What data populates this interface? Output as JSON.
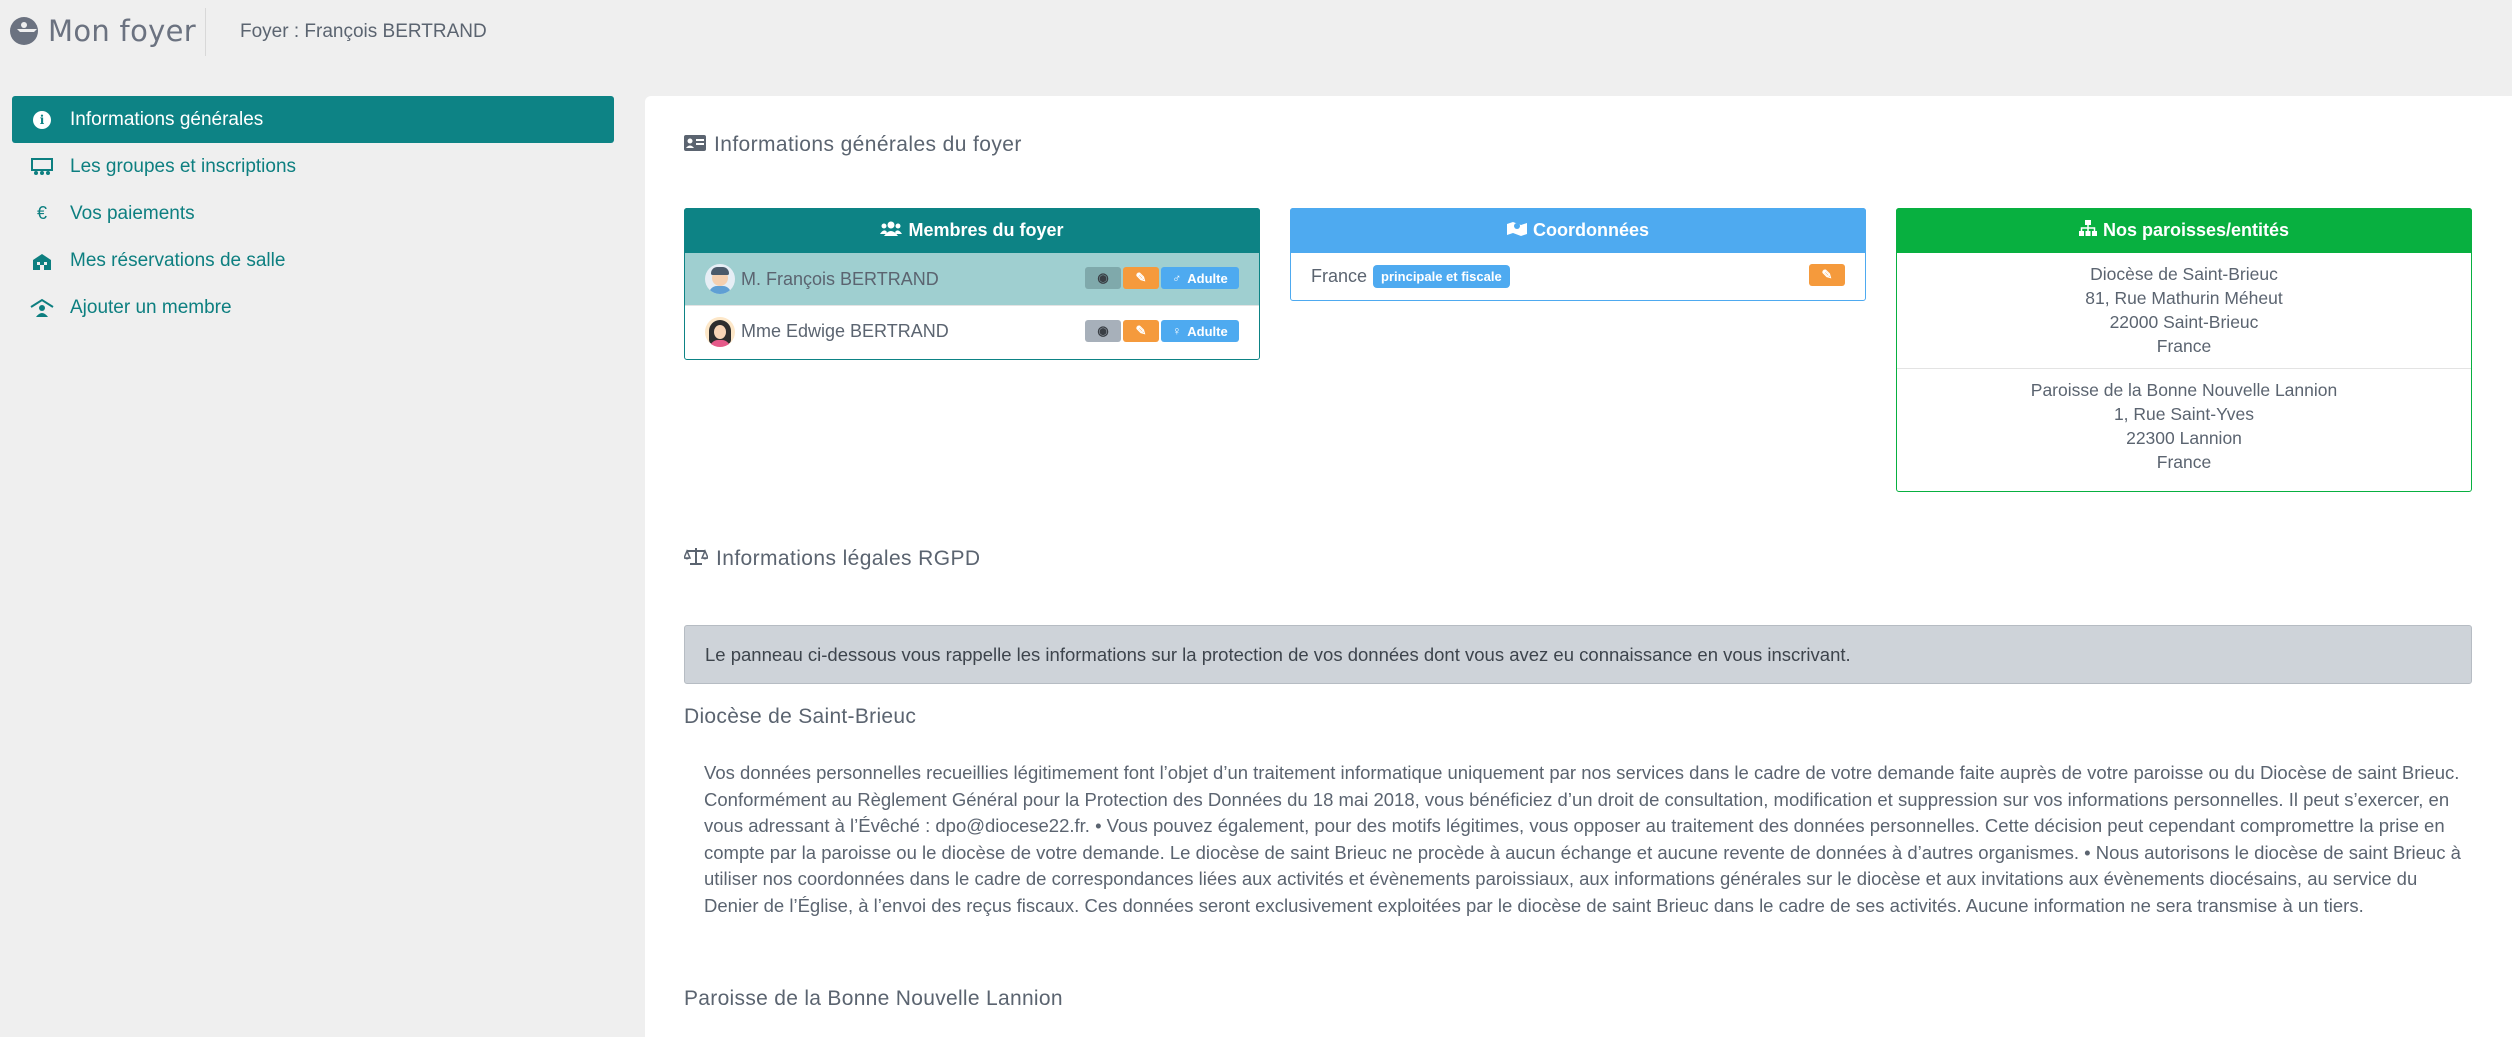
{
  "header": {
    "app_title": "Mon foyer",
    "foyer_label": "Foyer : François BERTRAND"
  },
  "sidebar": {
    "items": [
      {
        "label": "Informations générales",
        "icon": "info-icon",
        "active": true
      },
      {
        "label": "Les groupes et inscriptions",
        "icon": "group-icon",
        "active": false
      },
      {
        "label": "Vos paiements",
        "icon": "euro-icon",
        "active": false
      },
      {
        "label": "Mes réservations de salle",
        "icon": "building-icon",
        "active": false
      },
      {
        "label": "Ajouter un membre",
        "icon": "add-member-icon",
        "active": false
      }
    ]
  },
  "main": {
    "general_title": "Informations générales du foyer",
    "members_panel": {
      "title": "Membres du foyer",
      "color": "#0d8385",
      "members": [
        {
          "name": "M. François BERTRAND",
          "role": "Adulte"
        },
        {
          "name": "Mme Edwige BERTRAND",
          "role": "Adulte"
        }
      ]
    },
    "coords_panel": {
      "title": "Coordonnées",
      "color": "#4eaaf0",
      "country": "France",
      "badge": "principale et fiscale"
    },
    "parishes_panel": {
      "title": "Nos paroisses/entités",
      "color": "#08b040",
      "entities": [
        {
          "name": "Diocèse de Saint-Brieuc",
          "street": "81, Rue Mathurin Méheut",
          "city": "22000 Saint-Brieuc",
          "country": "France"
        },
        {
          "name": "Paroisse de la Bonne Nouvelle Lannion",
          "street": "1, Rue Saint-Yves",
          "city": "22300 Lannion",
          "country": "France"
        }
      ]
    },
    "legal_title": "Informations légales RGPD",
    "notice": "Le panneau ci-dessous vous rappelle les informations sur la protection de vos données dont vous avez eu connaissance en vous inscrivant.",
    "diocese_title": "Diocèse de Saint-Brieuc",
    "diocese_text": "Vos données personnelles recueillies légitimement font l’objet d’un traitement informatique uniquement par nos services dans le cadre de votre demande faite auprès de votre paroisse ou du Diocèse de saint Brieuc. Conformément au Règlement Général pour la Protection des Données du 18 mai 2018, vous bénéficiez d’un droit de consultation, modification et suppression sur vos informations personnelles. Il peut s’exercer, en vous adressant à l’Évêché : dpo@diocese22.fr. • Vous pouvez également, pour des motifs légitimes, vous opposer au traitement des données personnelles. Cette décision peut cependant compromettre la prise en compte par la paroisse ou le diocèse de votre demande. Le diocèse de saint Brieuc ne procède à aucun échange et aucune revente de données à d’autres organismes. • Nous autorisons le diocèse de saint Brieuc à utiliser nos coordonnées dans le cadre de correspondances liées aux activités et évènements paroissiaux, aux informations générales sur le diocèse et aux invitations aux évènements diocésains, au service du Denier de l’Église, à l’envoi des reçus fiscaux. Ces données seront exclusivement exploitées par le diocèse de saint Brieuc dans le cadre de ses activités. Aucune information ne sera transmise à un tiers.",
    "parish_title": "Paroisse de la Bonne Nouvelle Lannion"
  },
  "colors": {
    "primary": "#0d8385",
    "info": "#4eaaf0",
    "success": "#08b040",
    "warning": "#f59a3c"
  }
}
